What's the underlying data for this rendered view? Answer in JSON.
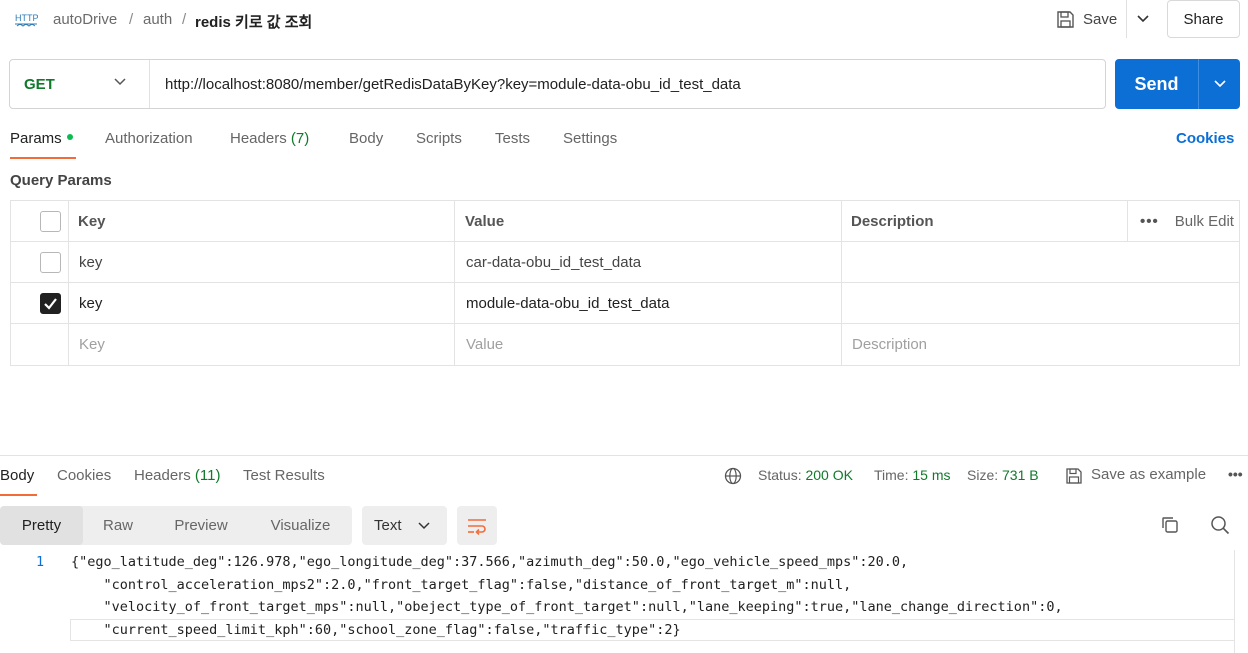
{
  "breadcrumb": {
    "items": [
      "autoDrive",
      "/",
      "auth",
      "/"
    ],
    "current": "redis 키로 값 조회",
    "icon": "http-icon"
  },
  "header": {
    "save_label": "Save",
    "share_label": "Share"
  },
  "request": {
    "method": "GET",
    "url": "http://localhost:8080/member/getRedisDataByKey?key=module-data-obu_id_test_data",
    "send_label": "Send"
  },
  "req_tabs": {
    "params": "Params",
    "authorization": "Authorization",
    "headers": "Headers",
    "headers_count": "(7)",
    "body": "Body",
    "scripts": "Scripts",
    "tests": "Tests",
    "settings": "Settings",
    "cookies": "Cookies"
  },
  "query_params": {
    "title": "Query Params",
    "columns": {
      "key": "Key",
      "value": "Value",
      "description": "Description",
      "bulk_edit": "Bulk Edit"
    },
    "rows": [
      {
        "checked": false,
        "key": "key",
        "value": "car-data-obu_id_test_data",
        "description": ""
      },
      {
        "checked": true,
        "key": "key",
        "value": "module-data-obu_id_test_data",
        "description": ""
      }
    ],
    "placeholders": {
      "key": "Key",
      "value": "Value",
      "description": "Description"
    }
  },
  "response": {
    "tabs": {
      "body": "Body",
      "cookies": "Cookies",
      "headers": "Headers",
      "headers_count": "(11)",
      "test_results": "Test Results"
    },
    "status_label": "Status:",
    "status_value": "200 OK",
    "time_label": "Time:",
    "time_value": "15 ms",
    "size_label": "Size:",
    "size_value": "731 B",
    "save_example": "Save as example",
    "views": [
      "Pretty",
      "Raw",
      "Preview",
      "Visualize"
    ],
    "format": "Text",
    "line_number": "1",
    "code_lines": [
      "{\"ego_latitude_deg\":126.978,\"ego_longitude_deg\":37.566,\"azimuth_deg\":50.0,\"ego_vehicle_speed_mps\":20.0,",
      "    \"control_acceleration_mps2\":2.0,\"front_target_flag\":false,\"distance_of_front_target_m\":null,",
      "    \"velocity_of_front_target_mps\":null,\"obeject_type_of_front_target\":null,\"lane_keeping\":true,\"lane_change_direction\":0,",
      "    \"current_speed_limit_kph\":60,\"school_zone_flag\":false,\"traffic_type\":2}"
    ]
  },
  "colors": {
    "accent": "#0b6fd6",
    "method_get": "#0f7a2a",
    "tab_underline": "#f26b3a",
    "status_ok": "#0f7a2a"
  }
}
